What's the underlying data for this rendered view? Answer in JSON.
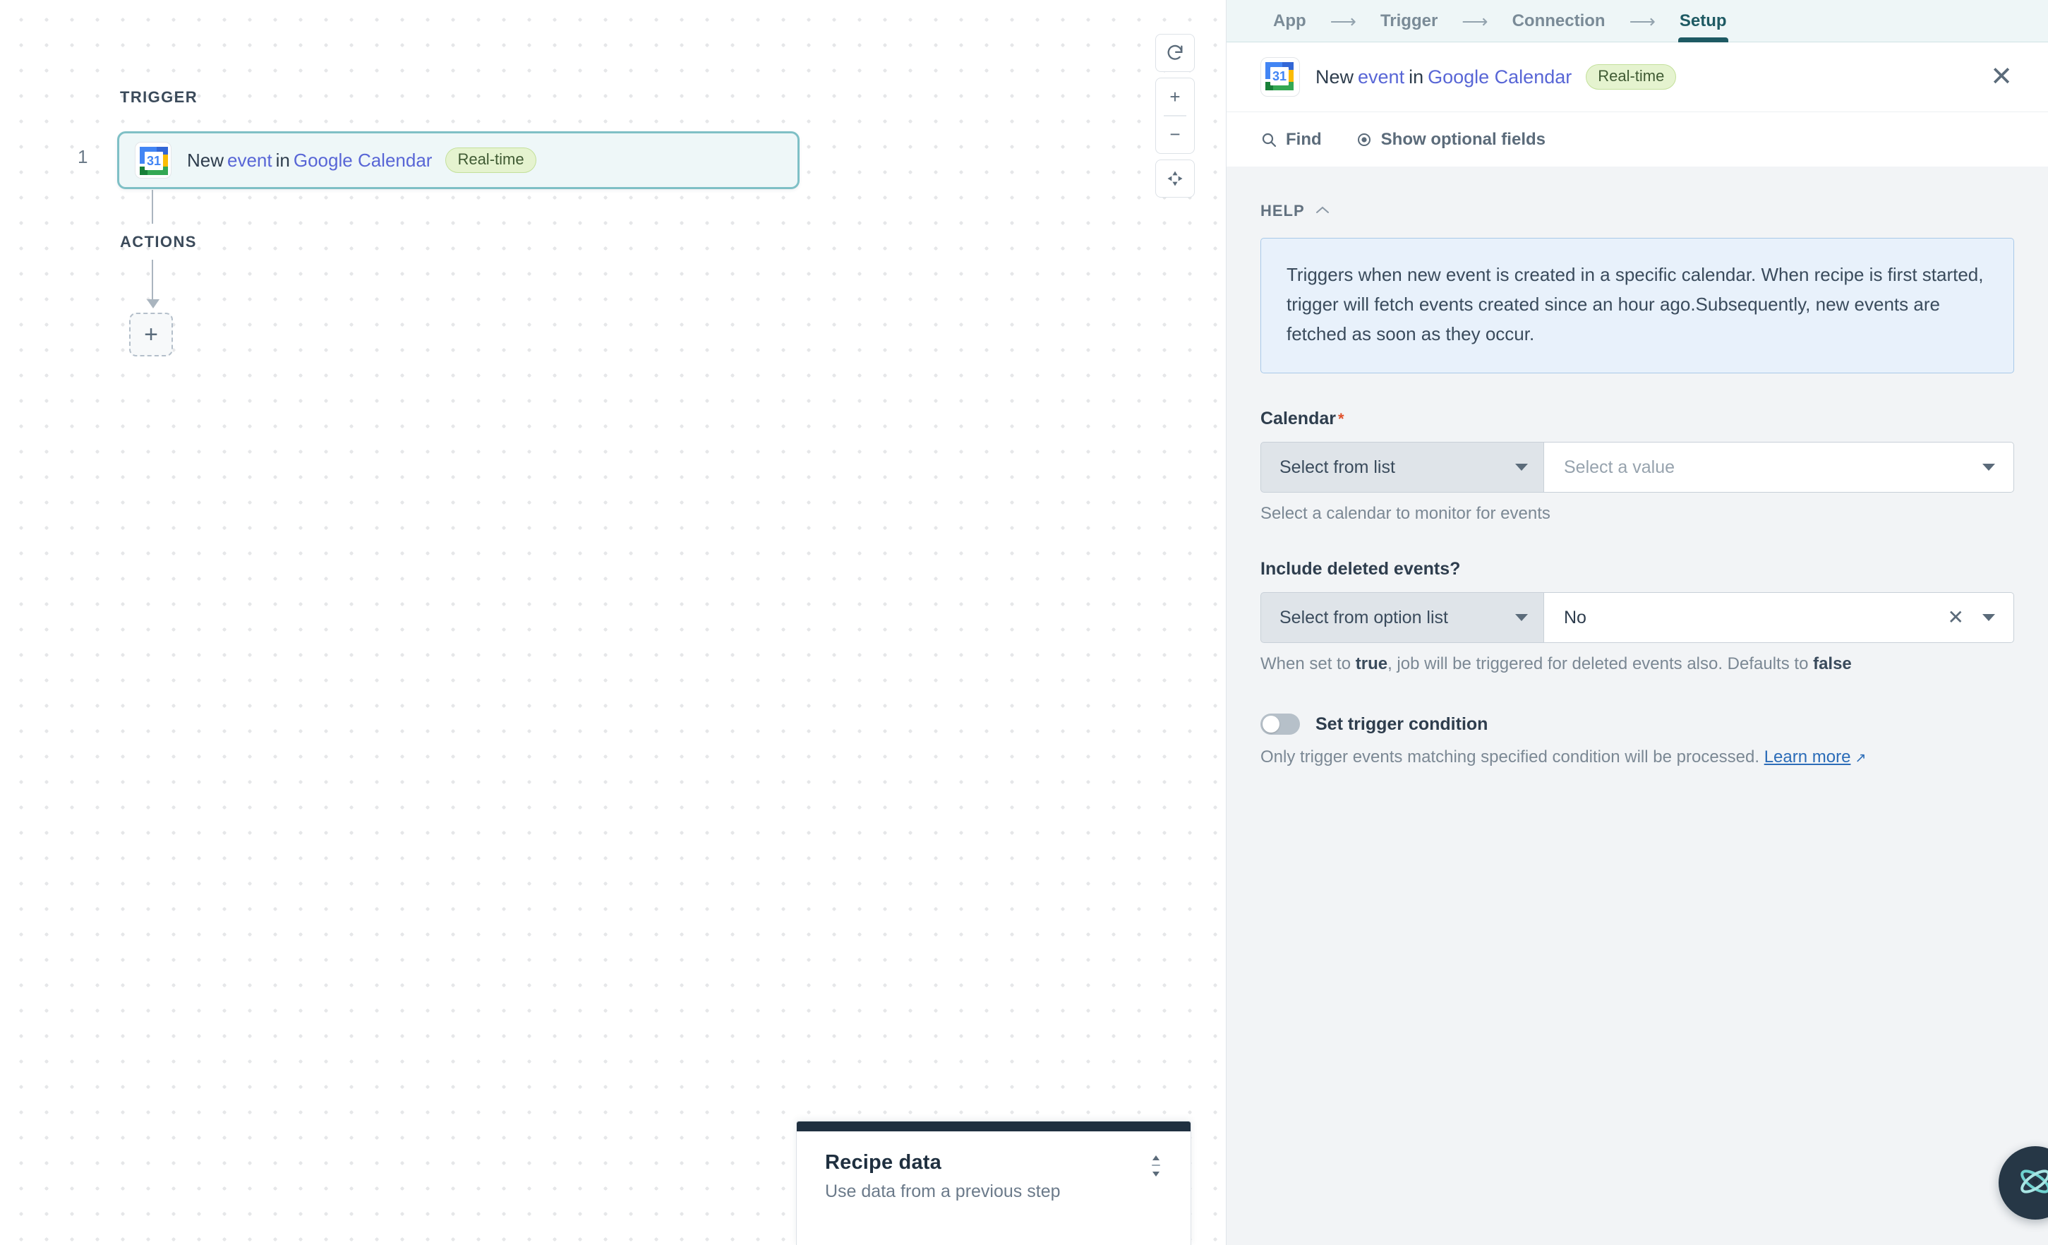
{
  "canvas": {
    "trigger_section_label": "TRIGGER",
    "actions_section_label": "ACTIONS",
    "step_number": "1",
    "node": {
      "text_new": "New",
      "text_event": "event",
      "text_in": "in",
      "text_app": "Google Calendar",
      "badge": "Real-time",
      "icon_name": "google-calendar-icon",
      "icon_day": "31"
    },
    "add_step_label": "+",
    "zoom_controls": {
      "reset_label": "↺",
      "zoom_in_label": "+",
      "zoom_out_label": "−",
      "fit_label": "fit-to-screen"
    },
    "recipe_data": {
      "title": "Recipe data",
      "subtitle": "Use data from a previous step"
    }
  },
  "panel": {
    "tabs": [
      {
        "label": "App",
        "active": false
      },
      {
        "label": "Trigger",
        "active": false
      },
      {
        "label": "Connection",
        "active": false
      },
      {
        "label": "Setup",
        "active": true
      }
    ],
    "tab_arrow": "⟶",
    "header": {
      "text_new": "New",
      "text_event": "event",
      "text_in": "in",
      "text_app": "Google Calendar",
      "badge": "Real-time",
      "close_label": "✕"
    },
    "toolbar": {
      "find_label": "Find",
      "optional_fields_label": "Show optional fields"
    },
    "help": {
      "section_label": "HELP",
      "collapse_label": "⌃",
      "body": "Triggers when new event is created in a specific calendar. When recipe is first started, trigger will fetch events created since an hour ago.Subsequently, new events are fetched as soon as they occur."
    },
    "fields": [
      {
        "label": "Calendar",
        "required": "*",
        "type_selector": "Select from list",
        "value": "",
        "placeholder": "Select a value",
        "hint": "Select a calendar to monitor for events",
        "has_clear": false
      },
      {
        "label": "Include deleted events?",
        "required": "",
        "type_selector": "Select from option list",
        "value": "No",
        "placeholder": "",
        "hint_prefix": "When set to ",
        "hint_bold1": "true",
        "hint_mid": ", job will be triggered for deleted events also. Defaults to ",
        "hint_bold2": "false",
        "has_clear": true
      }
    ],
    "trigger_condition": {
      "toggle_label": "Set trigger condition",
      "toggle_state": "off",
      "hint": "Only trigger events matching specified condition will be processed.",
      "link_label": "Learn more"
    },
    "assistant_fab": {
      "icon_name": "atom-icon"
    }
  },
  "colors": {
    "accent_teal": "#1e5a63",
    "node_border": "#7fc0c6",
    "node_fill": "#eef7f8",
    "badge_bg": "#e5f3cf",
    "link_blue": "#2b6cb8",
    "required_red": "#e0502a",
    "panel_bg": "#f2f4f6"
  }
}
